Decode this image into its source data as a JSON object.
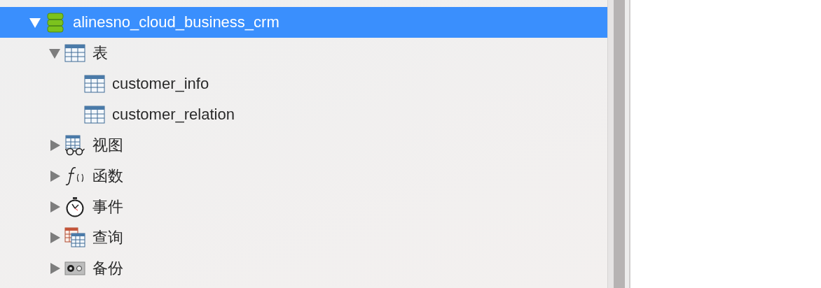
{
  "sidebar": {
    "tree": [
      {
        "label": "alinesno_cloud_business_crm",
        "kind": "database",
        "expanded": true,
        "selected": true,
        "children": [
          {
            "label": "表",
            "kind": "tables",
            "expanded": true,
            "selected": false,
            "children": [
              {
                "label": "customer_info",
                "kind": "table",
                "selected": false
              },
              {
                "label": "customer_relation",
                "kind": "table",
                "selected": false
              }
            ]
          },
          {
            "label": "视图",
            "kind": "views",
            "expanded": false,
            "selected": false
          },
          {
            "label": "函数",
            "kind": "functions",
            "expanded": false,
            "selected": false
          },
          {
            "label": "事件",
            "kind": "events",
            "expanded": false,
            "selected": false
          },
          {
            "label": "查询",
            "kind": "queries",
            "expanded": false,
            "selected": false
          },
          {
            "label": "备份",
            "kind": "backups",
            "expanded": false,
            "selected": false
          }
        ]
      }
    ]
  }
}
